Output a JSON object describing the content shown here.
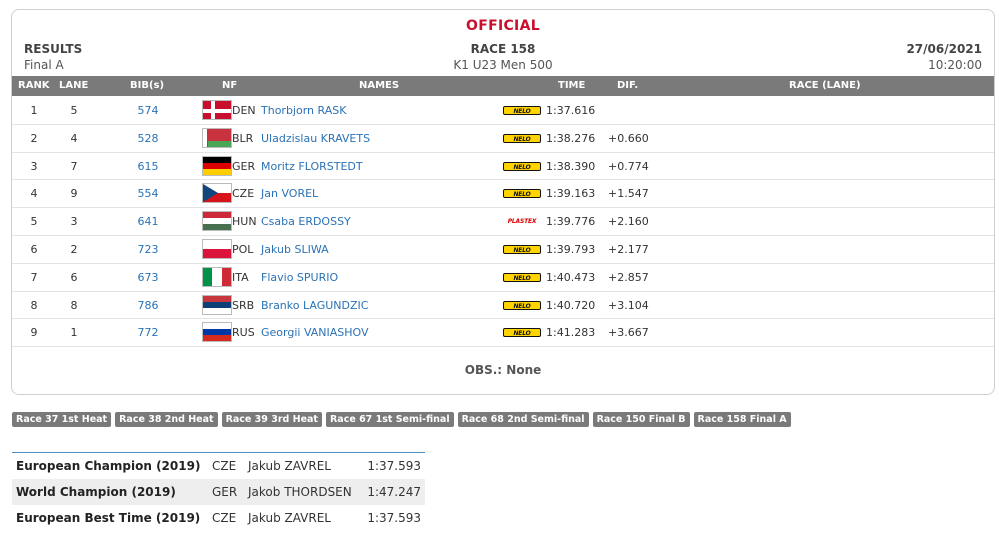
{
  "header": {
    "official": "OFFICIAL",
    "left_title": "RESULTS",
    "left_sub": "Final A",
    "center_title": "RACE 158",
    "center_sub": "K1 U23 Men 500",
    "right_title": "27/06/2021",
    "right_sub": "10:20:00"
  },
  "columns": {
    "rank": "RANK",
    "lane": "LANE",
    "bib": "BIB(s)",
    "nf": "NF",
    "names": "NAMES",
    "time": "TIME",
    "dif": "DIF.",
    "race_lane": "RACE (LANE)"
  },
  "results": [
    {
      "rank": "1",
      "lane": "5",
      "bib": "574",
      "nf": "DEN",
      "name": "Thorbjorn RASK",
      "brand": "NELO",
      "time": "1:37.616",
      "dif": "",
      "flag": {
        "type": "den",
        "colors": [
          "#c8102e",
          "#ffffff"
        ]
      }
    },
    {
      "rank": "2",
      "lane": "4",
      "bib": "528",
      "nf": "BLR",
      "name": "Uladzislau KRAVETS",
      "brand": "NELO",
      "time": "1:38.276",
      "dif": "+0.660",
      "flag": {
        "type": "blr",
        "colors": [
          "#c8313e",
          "#4aa657",
          "#ffffff"
        ]
      }
    },
    {
      "rank": "3",
      "lane": "7",
      "bib": "615",
      "nf": "GER",
      "name": "Moritz FLORSTEDT",
      "brand": "NELO",
      "time": "1:38.390",
      "dif": "+0.774",
      "flag": {
        "type": "h3",
        "colors": [
          "#000000",
          "#dd0000",
          "#ffce00"
        ]
      }
    },
    {
      "rank": "4",
      "lane": "9",
      "bib": "554",
      "nf": "CZE",
      "name": "Jan VOREL",
      "brand": "NELO",
      "time": "1:39.163",
      "dif": "+1.547",
      "flag": {
        "type": "cze",
        "colors": [
          "#ffffff",
          "#d7141a",
          "#11457e"
        ]
      }
    },
    {
      "rank": "5",
      "lane": "3",
      "bib": "641",
      "nf": "HUN",
      "name": "Csaba ERDOSSY",
      "brand": "PLASTEX",
      "time": "1:39.776",
      "dif": "+2.160",
      "flag": {
        "type": "h3",
        "colors": [
          "#ce2939",
          "#ffffff",
          "#477050"
        ]
      }
    },
    {
      "rank": "6",
      "lane": "2",
      "bib": "723",
      "nf": "POL",
      "name": "Jakub SLIWA",
      "brand": "NELO",
      "time": "1:39.793",
      "dif": "+2.177",
      "flag": {
        "type": "h2",
        "colors": [
          "#ffffff",
          "#dc143c"
        ]
      }
    },
    {
      "rank": "7",
      "lane": "6",
      "bib": "673",
      "nf": "ITA",
      "name": "Flavio SPURIO",
      "brand": "NELO",
      "time": "1:40.473",
      "dif": "+2.857",
      "flag": {
        "type": "v3",
        "colors": [
          "#009246",
          "#ffffff",
          "#ce2b37"
        ]
      }
    },
    {
      "rank": "8",
      "lane": "8",
      "bib": "786",
      "nf": "SRB",
      "name": "Branko LAGUNDZIC",
      "brand": "NELO",
      "time": "1:40.720",
      "dif": "+3.104",
      "flag": {
        "type": "h3",
        "colors": [
          "#c6363c",
          "#0c4076",
          "#ffffff"
        ]
      }
    },
    {
      "rank": "9",
      "lane": "1",
      "bib": "772",
      "nf": "RUS",
      "name": "Georgii VANIASHOV",
      "brand": "NELO",
      "time": "1:41.283",
      "dif": "+3.667",
      "flag": {
        "type": "h3",
        "colors": [
          "#ffffff",
          "#0039a6",
          "#d52b1e"
        ]
      }
    }
  ],
  "obs": "OBS.: None",
  "race_tabs": [
    "Race 37 1st Heat",
    "Race 38 2nd Heat",
    "Race 39 3rd Heat",
    "Race 67 1st Semi-final",
    "Race 68 2nd Semi-final",
    "Race 150 Final B",
    "Race 158 Final A"
  ],
  "records": [
    {
      "title": "European Champion (2019)",
      "nf": "CZE",
      "name": "Jakub ZAVREL",
      "time": "1:37.593"
    },
    {
      "title": "World Champion (2019)",
      "nf": "GER",
      "name": "Jakob THORDSEN",
      "time": "1:47.247"
    },
    {
      "title": "European Best Time (2019)",
      "nf": "CZE",
      "name": "Jakub ZAVREL",
      "time": "1:37.593"
    }
  ],
  "brand_text": {
    "NELO": "NELO",
    "PLASTEX": "PLASTEX"
  }
}
